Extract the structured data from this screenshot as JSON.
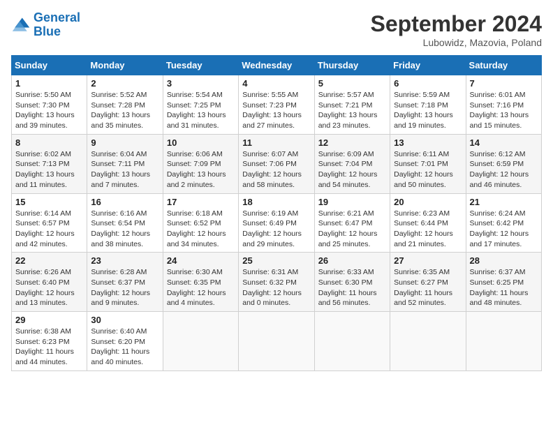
{
  "header": {
    "logo_line1": "General",
    "logo_line2": "Blue",
    "month_title": "September 2024",
    "location": "Lubowidz, Mazovia, Poland"
  },
  "calendar": {
    "days_of_week": [
      "Sunday",
      "Monday",
      "Tuesday",
      "Wednesday",
      "Thursday",
      "Friday",
      "Saturday"
    ],
    "weeks": [
      [
        {
          "day": "1",
          "info": "Sunrise: 5:50 AM\nSunset: 7:30 PM\nDaylight: 13 hours\nand 39 minutes."
        },
        {
          "day": "2",
          "info": "Sunrise: 5:52 AM\nSunset: 7:28 PM\nDaylight: 13 hours\nand 35 minutes."
        },
        {
          "day": "3",
          "info": "Sunrise: 5:54 AM\nSunset: 7:25 PM\nDaylight: 13 hours\nand 31 minutes."
        },
        {
          "day": "4",
          "info": "Sunrise: 5:55 AM\nSunset: 7:23 PM\nDaylight: 13 hours\nand 27 minutes."
        },
        {
          "day": "5",
          "info": "Sunrise: 5:57 AM\nSunset: 7:21 PM\nDaylight: 13 hours\nand 23 minutes."
        },
        {
          "day": "6",
          "info": "Sunrise: 5:59 AM\nSunset: 7:18 PM\nDaylight: 13 hours\nand 19 minutes."
        },
        {
          "day": "7",
          "info": "Sunrise: 6:01 AM\nSunset: 7:16 PM\nDaylight: 13 hours\nand 15 minutes."
        }
      ],
      [
        {
          "day": "8",
          "info": "Sunrise: 6:02 AM\nSunset: 7:13 PM\nDaylight: 13 hours\nand 11 minutes."
        },
        {
          "day": "9",
          "info": "Sunrise: 6:04 AM\nSunset: 7:11 PM\nDaylight: 13 hours\nand 7 minutes."
        },
        {
          "day": "10",
          "info": "Sunrise: 6:06 AM\nSunset: 7:09 PM\nDaylight: 13 hours\nand 2 minutes."
        },
        {
          "day": "11",
          "info": "Sunrise: 6:07 AM\nSunset: 7:06 PM\nDaylight: 12 hours\nand 58 minutes."
        },
        {
          "day": "12",
          "info": "Sunrise: 6:09 AM\nSunset: 7:04 PM\nDaylight: 12 hours\nand 54 minutes."
        },
        {
          "day": "13",
          "info": "Sunrise: 6:11 AM\nSunset: 7:01 PM\nDaylight: 12 hours\nand 50 minutes."
        },
        {
          "day": "14",
          "info": "Sunrise: 6:12 AM\nSunset: 6:59 PM\nDaylight: 12 hours\nand 46 minutes."
        }
      ],
      [
        {
          "day": "15",
          "info": "Sunrise: 6:14 AM\nSunset: 6:57 PM\nDaylight: 12 hours\nand 42 minutes."
        },
        {
          "day": "16",
          "info": "Sunrise: 6:16 AM\nSunset: 6:54 PM\nDaylight: 12 hours\nand 38 minutes."
        },
        {
          "day": "17",
          "info": "Sunrise: 6:18 AM\nSunset: 6:52 PM\nDaylight: 12 hours\nand 34 minutes."
        },
        {
          "day": "18",
          "info": "Sunrise: 6:19 AM\nSunset: 6:49 PM\nDaylight: 12 hours\nand 29 minutes."
        },
        {
          "day": "19",
          "info": "Sunrise: 6:21 AM\nSunset: 6:47 PM\nDaylight: 12 hours\nand 25 minutes."
        },
        {
          "day": "20",
          "info": "Sunrise: 6:23 AM\nSunset: 6:44 PM\nDaylight: 12 hours\nand 21 minutes."
        },
        {
          "day": "21",
          "info": "Sunrise: 6:24 AM\nSunset: 6:42 PM\nDaylight: 12 hours\nand 17 minutes."
        }
      ],
      [
        {
          "day": "22",
          "info": "Sunrise: 6:26 AM\nSunset: 6:40 PM\nDaylight: 12 hours\nand 13 minutes."
        },
        {
          "day": "23",
          "info": "Sunrise: 6:28 AM\nSunset: 6:37 PM\nDaylight: 12 hours\nand 9 minutes."
        },
        {
          "day": "24",
          "info": "Sunrise: 6:30 AM\nSunset: 6:35 PM\nDaylight: 12 hours\nand 4 minutes."
        },
        {
          "day": "25",
          "info": "Sunrise: 6:31 AM\nSunset: 6:32 PM\nDaylight: 12 hours\nand 0 minutes."
        },
        {
          "day": "26",
          "info": "Sunrise: 6:33 AM\nSunset: 6:30 PM\nDaylight: 11 hours\nand 56 minutes."
        },
        {
          "day": "27",
          "info": "Sunrise: 6:35 AM\nSunset: 6:27 PM\nDaylight: 11 hours\nand 52 minutes."
        },
        {
          "day": "28",
          "info": "Sunrise: 6:37 AM\nSunset: 6:25 PM\nDaylight: 11 hours\nand 48 minutes."
        }
      ],
      [
        {
          "day": "29",
          "info": "Sunrise: 6:38 AM\nSunset: 6:23 PM\nDaylight: 11 hours\nand 44 minutes."
        },
        {
          "day": "30",
          "info": "Sunrise: 6:40 AM\nSunset: 6:20 PM\nDaylight: 11 hours\nand 40 minutes."
        },
        null,
        null,
        null,
        null,
        null
      ]
    ]
  }
}
